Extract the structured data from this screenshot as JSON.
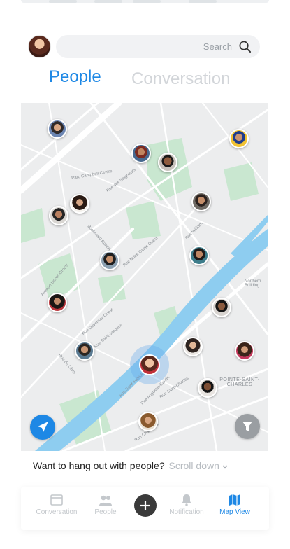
{
  "search": {
    "placeholder": "Search"
  },
  "tabs": [
    {
      "label": "People",
      "active": true
    },
    {
      "label": "Conversation",
      "active": false
    }
  ],
  "map": {
    "streets": [
      "Parc Campbell Centre",
      "Rue des Seigneurs",
      "Boulevard Robert",
      "Rue Notre Dame Ouest",
      "Avenue Lionel-Groulx",
      "Rue William",
      "Rue Duvernay Ouest",
      "Rue Saint-Jacques",
      "Rue de Lévis",
      "Rue Saint-Patrick",
      "Rue Augustin-Cantin",
      "Rue Saint-Charles",
      "Rue Charlevoix",
      "POINTE-SAINT-CHARLES",
      "Northern Building"
    ],
    "locate_icon": "navigation-arrow-icon",
    "filter_icon": "filter-funnel-icon"
  },
  "prompt": {
    "question": "Want to hang out with people?",
    "hint": "Scroll down"
  },
  "nav": [
    {
      "label": "Conversation",
      "icon": "chat-window-icon"
    },
    {
      "label": "People",
      "icon": "people-icon"
    },
    {
      "label": "",
      "icon": "plus-icon"
    },
    {
      "label": "Notification",
      "icon": "bell-icon"
    },
    {
      "label": "Map View",
      "icon": "map-icon",
      "active": true
    }
  ],
  "colors": {
    "accent": "#1e88e5",
    "inactive": "#c4c8cc",
    "river": "#8ecdf0",
    "park": "#c9e7d0"
  }
}
